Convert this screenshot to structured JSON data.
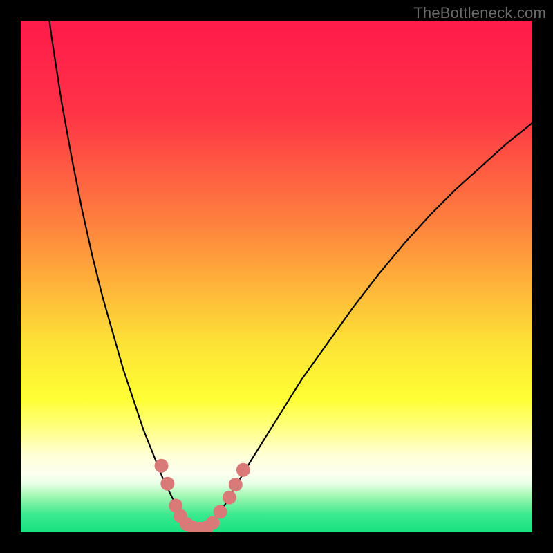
{
  "watermark": "TheBottleneck.com",
  "chart_data": {
    "type": "line",
    "title": "",
    "xlabel": "",
    "ylabel": "",
    "xlim": [
      0,
      100
    ],
    "ylim": [
      0,
      100
    ],
    "background_gradient": {
      "stops": [
        {
          "offset": 0.0,
          "color": "#ff1a4b"
        },
        {
          "offset": 0.18,
          "color": "#ff3346"
        },
        {
          "offset": 0.4,
          "color": "#fe833e"
        },
        {
          "offset": 0.63,
          "color": "#fde236"
        },
        {
          "offset": 0.74,
          "color": "#feff34"
        },
        {
          "offset": 0.8,
          "color": "#ffff88"
        },
        {
          "offset": 0.85,
          "color": "#ffffd6"
        },
        {
          "offset": 0.885,
          "color": "#fdfff1"
        },
        {
          "offset": 0.905,
          "color": "#e8ffe7"
        },
        {
          "offset": 0.93,
          "color": "#9ff7b0"
        },
        {
          "offset": 0.965,
          "color": "#3ce990"
        },
        {
          "offset": 1.0,
          "color": "#17e281"
        }
      ]
    },
    "series": [
      {
        "name": "bottleneck-curve",
        "color": "#000000",
        "width": 2.2,
        "x": [
          0,
          2,
          4,
          6,
          8,
          10,
          12,
          14,
          16,
          18,
          20,
          22,
          24,
          26,
          28,
          30,
          31,
          32,
          33,
          34,
          35,
          36,
          37,
          38,
          40,
          42,
          45,
          50,
          55,
          60,
          65,
          70,
          75,
          80,
          85,
          90,
          95,
          100
        ],
        "y": [
          150,
          130,
          112,
          97,
          84,
          73,
          63,
          54,
          46,
          39,
          32,
          26,
          20,
          15,
          10,
          6,
          4,
          2.5,
          1.4,
          0.8,
          0.6,
          0.8,
          1.4,
          2.6,
          5.5,
          9,
          14,
          22,
          30,
          37,
          44,
          50.5,
          56.5,
          62,
          67,
          71.5,
          76,
          80
        ]
      }
    ],
    "scatter": {
      "name": "sample-points",
      "color": "#d97a78",
      "radius": 10,
      "points": [
        {
          "x": 27.5,
          "y": 13
        },
        {
          "x": 28.7,
          "y": 9.5
        },
        {
          "x": 30.3,
          "y": 5.2
        },
        {
          "x": 31.2,
          "y": 3.2
        },
        {
          "x": 32.4,
          "y": 1.6
        },
        {
          "x": 33.7,
          "y": 0.9
        },
        {
          "x": 35.0,
          "y": 0.7
        },
        {
          "x": 36.3,
          "y": 0.9
        },
        {
          "x": 37.5,
          "y": 1.8
        },
        {
          "x": 39.0,
          "y": 4.0
        },
        {
          "x": 40.8,
          "y": 6.8
        },
        {
          "x": 42.0,
          "y": 9.3
        },
        {
          "x": 43.5,
          "y": 12.2
        }
      ]
    }
  }
}
